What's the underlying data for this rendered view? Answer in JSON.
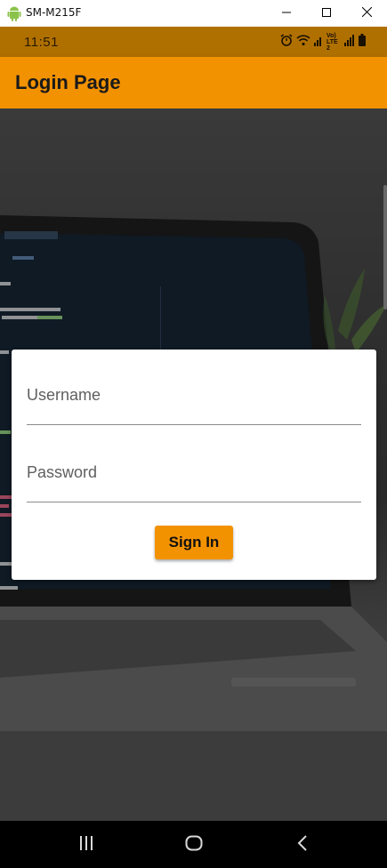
{
  "window": {
    "title": "SM-M215F",
    "app_icon": "android-icon",
    "controls": [
      "minimize-icon",
      "maximize-icon",
      "close-icon"
    ]
  },
  "status_bar": {
    "time": "11:51",
    "icons": [
      "alarm-icon",
      "wifi-icon",
      "signal-icon",
      "volte-icon",
      "signal-icon",
      "battery-icon"
    ],
    "volte_label": "Vo) LTE2"
  },
  "app_bar": {
    "title": "Login Page"
  },
  "login_form": {
    "username_placeholder": "Username",
    "username_value": "",
    "password_placeholder": "Password",
    "password_value": "",
    "sign_in_label": "Sign In"
  },
  "nav_bar": {
    "icons": [
      "recents-icon",
      "home-icon",
      "back-icon"
    ]
  },
  "colors": {
    "accent": "#f39200",
    "status_bar": "#b07000",
    "nav_bar": "#000000",
    "card": "#ffffff"
  }
}
